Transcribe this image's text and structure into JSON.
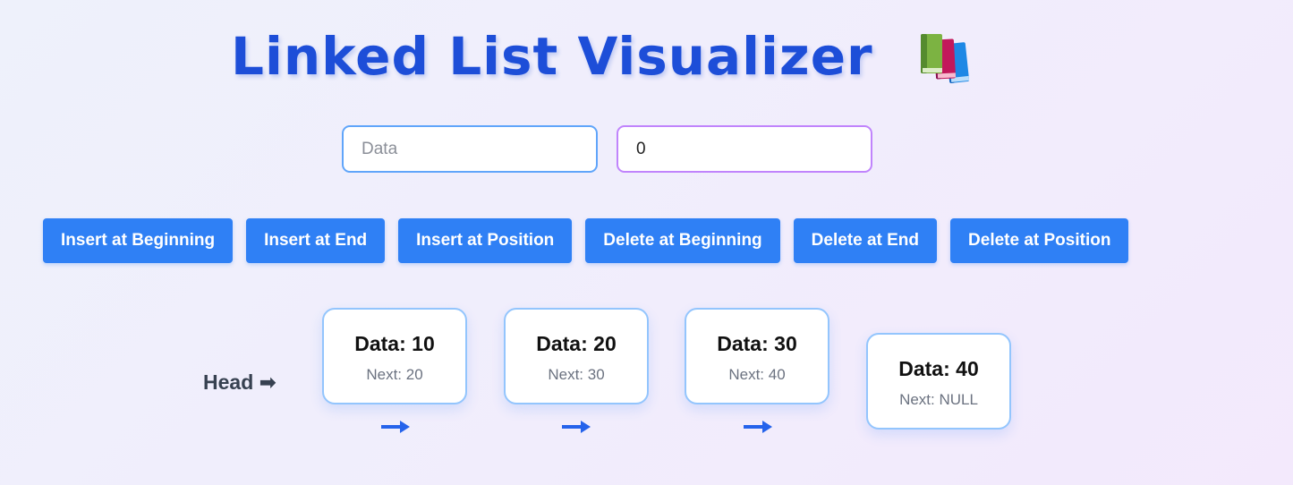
{
  "header": {
    "title": "Linked List Visualizer",
    "icon": "books-icon"
  },
  "inputs": {
    "data_placeholder": "Data",
    "data_value": "",
    "position_value": "0"
  },
  "buttons": [
    "Insert at Beginning",
    "Insert at End",
    "Insert at Position",
    "Delete at Beginning",
    "Delete at End",
    "Delete at Position"
  ],
  "list": {
    "head_label": "Head ➡",
    "nodes": [
      {
        "data": "Data: 10",
        "next": "Next: 20"
      },
      {
        "data": "Data: 20",
        "next": "Next: 30"
      },
      {
        "data": "Data: 30",
        "next": "Next: 40"
      },
      {
        "data": "Data: 40",
        "next": "Next: NULL"
      }
    ],
    "arrow_icon": "right-arrow-icon"
  },
  "colors": {
    "title": "#1d4ed8",
    "button": "#2f80f5",
    "data_input_border": "#60a5fa",
    "position_input_border": "#c084fc",
    "node_border": "#93c5fd",
    "arrow": "#2563eb"
  }
}
